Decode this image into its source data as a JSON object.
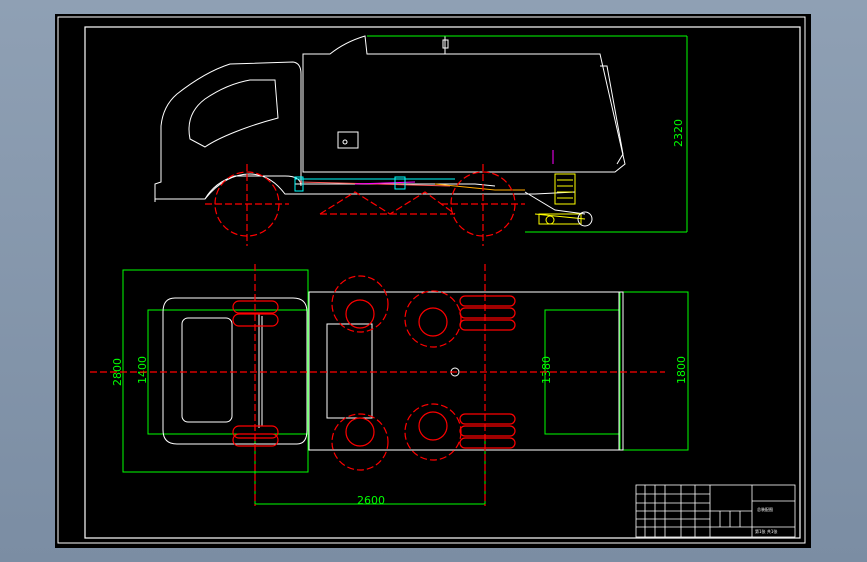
{
  "drawing": {
    "dimensions": {
      "height_side": "2320",
      "width_total": "2800",
      "width_inner": "1400",
      "track_rear": "1380",
      "body_width": "1800",
      "wheelbase": "2600"
    },
    "title_block": {
      "drawing_name": "总装配图",
      "sheet": "第1张 共1张"
    }
  },
  "colors": {
    "background": "#000000",
    "outline": "#ffffff",
    "dimension": "#00ff00",
    "centerline": "#ff0000",
    "hydraulics": "#00ffff",
    "brush": "#ffff00",
    "marker": "#ff00ff"
  }
}
